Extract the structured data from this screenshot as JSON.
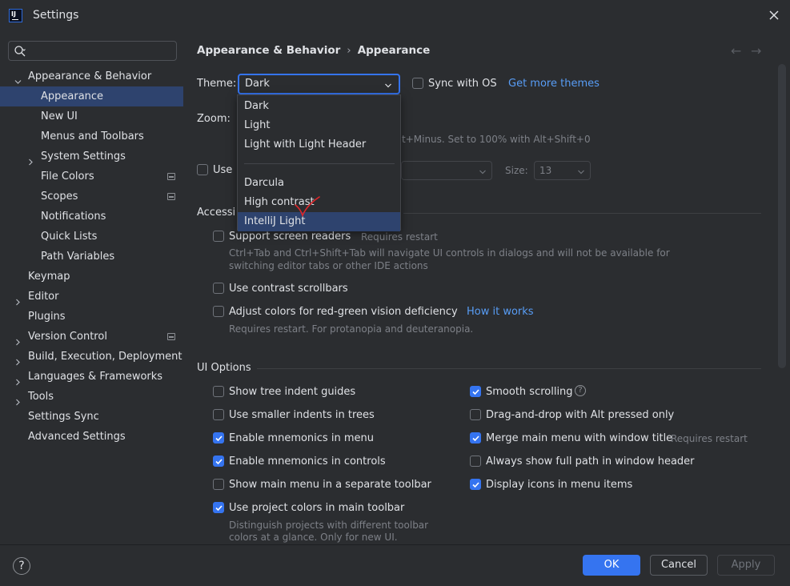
{
  "window": {
    "logo_text": "IJ",
    "title": "Settings"
  },
  "sidebar": {
    "search_placeholder": "",
    "items": [
      {
        "label": "Appearance & Behavior",
        "expanded": true
      },
      {
        "label": "Appearance",
        "selected": true
      },
      {
        "label": "New UI"
      },
      {
        "label": "Menus and Toolbars"
      },
      {
        "label": "System Settings"
      },
      {
        "label": "File Colors"
      },
      {
        "label": "Scopes"
      },
      {
        "label": "Notifications"
      },
      {
        "label": "Quick Lists"
      },
      {
        "label": "Path Variables"
      },
      {
        "label": "Keymap"
      },
      {
        "label": "Editor"
      },
      {
        "label": "Plugins"
      },
      {
        "label": "Version Control"
      },
      {
        "label": "Build, Execution, Deployment"
      },
      {
        "label": "Languages & Frameworks"
      },
      {
        "label": "Tools"
      },
      {
        "label": "Settings Sync"
      },
      {
        "label": "Advanced Settings"
      }
    ]
  },
  "breadcrumb": {
    "parent": "Appearance & Behavior",
    "separator": "›",
    "current": "Appearance"
  },
  "nav": {
    "back": "←",
    "forward": "→"
  },
  "theme": {
    "label": "Theme:",
    "value": "Dark",
    "sync_label": "Sync with OS",
    "more_link": "Get more themes",
    "options": [
      "Dark",
      "Light",
      "Light with Light Header",
      "Darcula",
      "High contrast",
      "IntelliJ Light"
    ],
    "highlighted": "IntelliJ Light"
  },
  "zoom": {
    "label": "Zoom:",
    "hint": "t+Minus. Set to 100% with Alt+Shift+0"
  },
  "font": {
    "use_label": "Use",
    "size_label": "Size:",
    "size_value": "13"
  },
  "accessibility": {
    "title": "Accessi",
    "screen_readers": {
      "label": "Support screen readers",
      "hint": "Requires restart",
      "checked": false
    },
    "screen_readers_desc_1": "Ctrl+Tab and Ctrl+Shift+Tab will navigate UI controls in dialogs and will not be available for",
    "screen_readers_desc_2": "switching editor tabs or other IDE actions",
    "contrast_scrollbars": {
      "label": "Use contrast scrollbars",
      "checked": false
    },
    "red_green": {
      "label": "Adjust colors for red-green vision deficiency",
      "link": "How it works",
      "checked": false
    },
    "red_green_desc": "Requires restart. For protanopia and deuteranopia."
  },
  "ui_options": {
    "title": "UI Options",
    "left": [
      {
        "label": "Show tree indent guides",
        "checked": false
      },
      {
        "label": "Use smaller indents in trees",
        "checked": false
      },
      {
        "label": "Enable mnemonics in menu",
        "checked": true
      },
      {
        "label": "Enable mnemonics in controls",
        "checked": true
      },
      {
        "label": "Show main menu in a separate toolbar",
        "checked": false
      },
      {
        "label": "Use project colors in main toolbar",
        "checked": true
      }
    ],
    "right": [
      {
        "label": "Smooth scrolling",
        "checked": true
      },
      {
        "label": "Drag-and-drop with Alt pressed only",
        "checked": false
      },
      {
        "label": "Merge main menu with window title",
        "hint": "Requires restart",
        "checked": true
      },
      {
        "label": "Always show full path in window header",
        "checked": false
      },
      {
        "label": "Display icons in menu items",
        "checked": true
      }
    ],
    "project_colors_desc_1": "Distinguish projects with different toolbar",
    "project_colors_desc_2": "colors at a glance. Only for new UI.",
    "help_glyph": "?"
  },
  "footer": {
    "help_glyph": "?",
    "ok": "OK",
    "cancel": "Cancel",
    "apply": "Apply"
  },
  "colors": {
    "background": "#2b2d30",
    "accent": "#3574f0",
    "selection": "#2e436e",
    "link": "#589df6",
    "annotation": "#e0262a"
  }
}
